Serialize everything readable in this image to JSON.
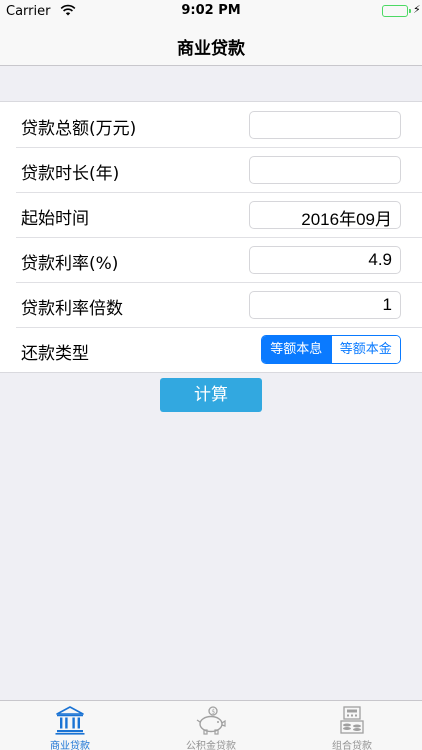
{
  "status_bar": {
    "carrier": "Carrier",
    "time": "9:02 PM",
    "battery_charging": "⚡"
  },
  "nav": {
    "title": "商业贷款"
  },
  "form": {
    "rows": [
      {
        "label": "贷款总额(万元)",
        "value": ""
      },
      {
        "label": "贷款时长(年)",
        "value": ""
      },
      {
        "label": "起始时间",
        "value": "2016年09月"
      },
      {
        "label": "贷款利率(%)",
        "value": "4.9"
      },
      {
        "label": "贷款利率倍数",
        "value": "1"
      }
    ],
    "repayment": {
      "label": "还款类型",
      "options": [
        "等额本息",
        "等额本金"
      ],
      "selected": "等额本息"
    }
  },
  "calc_button": {
    "label": "计算"
  },
  "tabs": [
    {
      "label": "商业贷款",
      "icon": "bank-icon",
      "active": true
    },
    {
      "label": "公积金贷款",
      "icon": "piggy-bank-icon",
      "active": false
    },
    {
      "label": "组合贷款",
      "icon": "calculator-coins-icon",
      "active": false
    }
  ],
  "colors": {
    "accent": "#0a7aff",
    "button": "#32a8e0",
    "tab_active": "#1a73d4",
    "tab_inactive": "#929292"
  }
}
